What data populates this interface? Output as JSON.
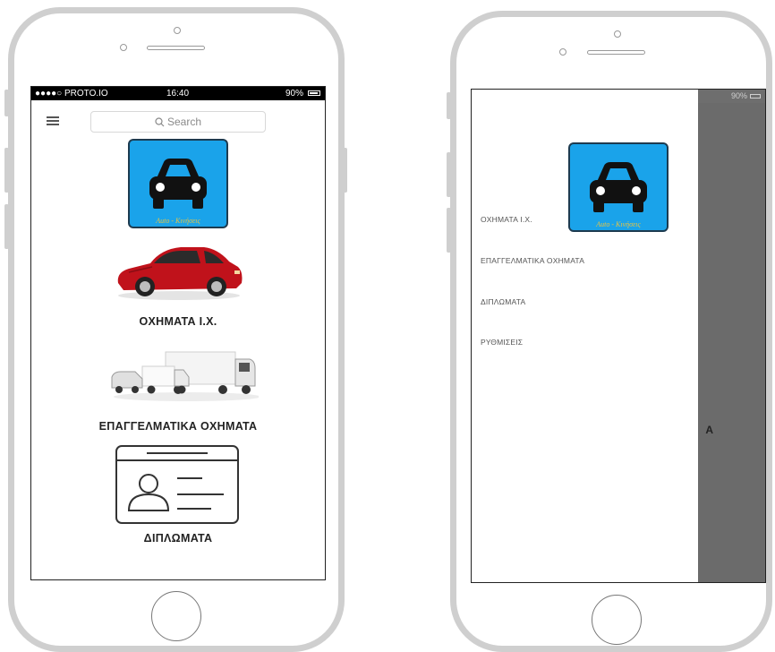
{
  "left_screen": {
    "status_bar": {
      "carrier": "●●●●○ PROTO.IO",
      "time": "16:40",
      "battery": "90%"
    },
    "search": {
      "placeholder": "Search"
    },
    "logo": {
      "text": "Auto - Κινήσεις"
    },
    "categories": [
      {
        "label": "ΟΧΗΜΑΤΑ Ι.Χ.",
        "icon": "red-car-image"
      },
      {
        "label": "ΕΠΑΓΓΕΛΜΑΤΙΚΑ ΟΧΗΜΑΤΑ",
        "icon": "trucks-image"
      },
      {
        "label": "ΔΙΠΛΩΜΑΤΑ",
        "icon": "id-card-icon"
      }
    ]
  },
  "right_screen": {
    "status_bar": {
      "battery": "90%"
    },
    "logo": {
      "text": "Auto - Κινήσεις"
    },
    "drawer_items": [
      {
        "label": "ΟΧΗΜΑΤΑ Ι.Χ."
      },
      {
        "label": "ΕΠΑΓΓΕΛΜΑΤΙΚΑ ΟΧΗΜΑΤΑ"
      },
      {
        "label": "ΔΙΠΛΩΜΑΤΑ"
      },
      {
        "label": "ΡΥΘΜΙΣΕΙΣ"
      }
    ],
    "overlay_fragment": "Α"
  },
  "colors": {
    "logo_bg": "#1aa3ea",
    "overlay": "#6b6b6b",
    "car_red": "#c0121b"
  }
}
